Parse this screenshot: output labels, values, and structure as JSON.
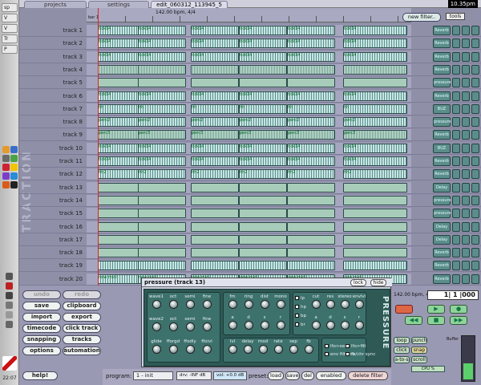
{
  "dock": {
    "items": [
      "sp",
      "V",
      "V",
      "Tr",
      "P"
    ],
    "clock": "22:07"
  },
  "topbar": {
    "tabs": [
      "projects",
      "settings",
      "edit_060312_113945_5"
    ],
    "active_tab": 2,
    "clock": "10.35pm"
  },
  "arrange": {
    "tempo": "142.00 bpm, 4/4",
    "bar_start": "bar 1",
    "new_filter": "new filter..",
    "tools": "tools",
    "side_label": "TRACTION",
    "tracks": [
      {
        "label": "track 1",
        "clip": "midi",
        "clip_text": "tick14"
      },
      {
        "label": "track 2",
        "clip": "midi",
        "clip_text": "tick14"
      },
      {
        "label": "track 3",
        "clip": "midi",
        "clip_text": "tick14"
      },
      {
        "label": "track 4",
        "clip": "wave",
        "clip_text": ""
      },
      {
        "label": "track 5",
        "clip": "audio",
        "clip_text": ""
      },
      {
        "label": "track 6",
        "clip": "midi",
        "clip_text": "tick14"
      },
      {
        "label": "track 7",
        "clip": "midi",
        "clip_text": "hh"
      },
      {
        "label": "track 8",
        "clip": "midi",
        "clip_text": "perc2"
      },
      {
        "label": "track 9",
        "clip": "wave",
        "clip_text": "perc3"
      },
      {
        "label": "track 10",
        "clip": "midi",
        "clip_text": "tick14"
      },
      {
        "label": "track 11",
        "clip": "midi",
        "clip_text": "tick14"
      },
      {
        "label": "track 12",
        "clip": "midi",
        "clip_text": "hh2"
      },
      {
        "label": "track 13",
        "clip": "audio",
        "clip_text": ""
      },
      {
        "label": "track 14",
        "clip": "audio",
        "clip_text": ""
      },
      {
        "label": "track 15",
        "clip": "audio",
        "clip_text": ""
      },
      {
        "label": "track 16",
        "clip": "audio",
        "clip_text": ""
      },
      {
        "label": "track 17",
        "clip": "audio",
        "clip_text": ""
      },
      {
        "label": "track 18",
        "clip": "audio",
        "clip_text": ""
      },
      {
        "label": "track 19",
        "clip": "midi",
        "clip_text": ""
      },
      {
        "label": "track 20",
        "clip": "midi",
        "clip_text": "new midi"
      }
    ],
    "filters": [
      "Reverb",
      "Reverb",
      "Reverb",
      "Reverb",
      "pressure",
      "Reverb",
      "BUZ",
      "pressure",
      "Reverb",
      "BUZ",
      "Reverb",
      "Reverb",
      "Delay",
      "pressure",
      "pressure",
      "Delay",
      "Delay",
      "Reverb",
      "Reverb",
      "Reverb"
    ]
  },
  "controls": {
    "undo": "undo",
    "redo": "redo",
    "save": "save",
    "clipboard": "clipboard",
    "import": "import",
    "export": "export",
    "timecode": "timecode",
    "click_track": "click track",
    "snapping": "snapping",
    "tracks": "tracks",
    "options": "options",
    "automation": "automation",
    "help": "help!"
  },
  "plugin": {
    "title": "pressure (track 13)",
    "lock": "lock",
    "hide": "hide",
    "logo": "PRESSURE",
    "osc_labels": [
      "wave1",
      "oct",
      "semi",
      "fine",
      "wave2",
      "oct",
      "semi",
      "fine",
      "glide",
      "fforgd",
      "ffodly",
      "ffoivl"
    ],
    "filter_labels": [
      "fm",
      "ring",
      "dist",
      "mono",
      "a",
      "d",
      "s",
      "r"
    ],
    "filter_types": [
      "lp",
      "hp",
      "bp",
      "br"
    ],
    "env_labels": [
      "cut",
      "res",
      "stereo",
      "envlvl",
      "a",
      "d",
      "s",
      "r"
    ],
    "lfo_labels": [
      "lvl",
      "delay",
      "mod",
      "rate",
      "sep",
      "fb"
    ],
    "toggles": [
      "lfo>osc",
      "lfo>filt",
      "env filt env",
      "fb/chr sync"
    ]
  },
  "programbar": {
    "program_label": "program:",
    "program_value": "1 - init",
    "drv": "drv: -INF dB",
    "vol": "vol: +0.0 dB",
    "preset_label": "preset:",
    "load": "load",
    "save": "save",
    "del": "del",
    "enabled": "enabled",
    "delete_filter": "delete filter"
  },
  "transport": {
    "tempo": "142.00 bpm, 4/4",
    "position": "1| 1 |000",
    "loop": "loop",
    "punch": "punch",
    "click": "click",
    "snap": "snap",
    "autoscroll": "a-to-s",
    "scroll": "scroll",
    "buffer": "Buffer",
    "cpu": "CPU %"
  }
}
